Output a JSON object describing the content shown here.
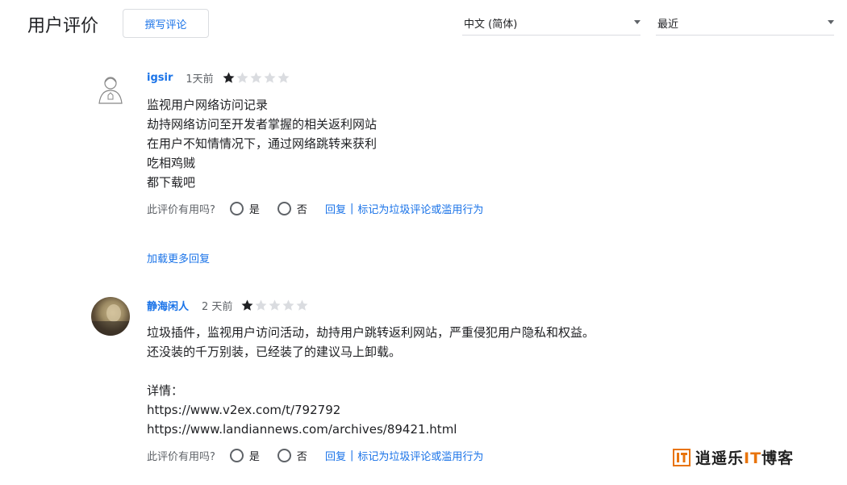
{
  "header": {
    "title": "用户评价",
    "write_review": "撰写评论",
    "language": "中文 (简体)",
    "sort": "最近"
  },
  "reviews": [
    {
      "author": "igsir",
      "time": "1天前",
      "rating": 1,
      "lines": [
        "监视用户网络访问记录",
        "劫持网络访问至开发者掌握的相关返利网站",
        "在用户不知情情况下，通过网络跳转来获利",
        "吃相鸡贼",
        "都下载吧"
      ]
    },
    {
      "author": "静海闲人",
      "time": "2 天前",
      "rating": 1,
      "lines": [
        "垃圾插件，监视用户访问活动，劫持用户跳转返利网站，严重侵犯用户隐私和权益。",
        "还没装的千万别装，已经装了的建议马上卸载。",
        "",
        "详情：",
        "https://www.v2ex.com/t/792792",
        "https://www.landiannews.com/archives/89421.html"
      ]
    }
  ],
  "helpful": {
    "question": "此评价有用吗?",
    "yes": "是",
    "no": "否",
    "reply": "回复",
    "separator": "|",
    "report": "标记为垃圾评论或滥用行为"
  },
  "load_more": "加载更多回复",
  "watermark": {
    "prefix": "逍遥乐",
    "it": "IT",
    "suffix": "博客"
  },
  "colors": {
    "link": "#1a73e8",
    "star_filled": "#202124",
    "star_empty": "#dadce0",
    "watermark_accent": "#e8740c"
  }
}
